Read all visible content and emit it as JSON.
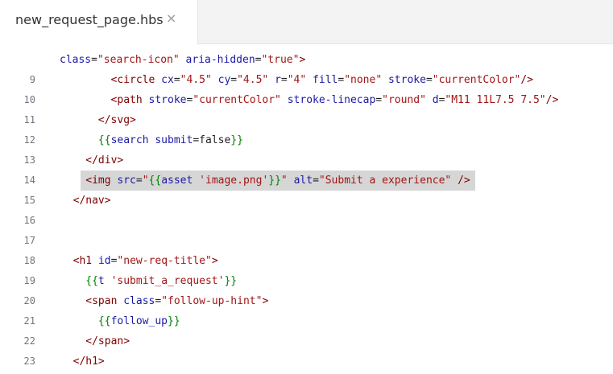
{
  "tab": {
    "filename": "new_request_page.hbs",
    "close_glyph": "×"
  },
  "lines": [
    {
      "number": "",
      "indent": 0,
      "highlight": false,
      "tokens": [
        {
          "t": "attr",
          "v": "class"
        },
        {
          "t": "plain",
          "v": "="
        },
        {
          "t": "str",
          "v": "\"search-icon\""
        },
        {
          "t": "plain",
          "v": " "
        },
        {
          "t": "attr",
          "v": "aria-hidden"
        },
        {
          "t": "plain",
          "v": "="
        },
        {
          "t": "str",
          "v": "\"true\""
        },
        {
          "t": "tag",
          "v": ">"
        }
      ]
    },
    {
      "number": "9",
      "indent": 8,
      "highlight": false,
      "tokens": [
        {
          "t": "tag",
          "v": "<circle"
        },
        {
          "t": "plain",
          "v": " "
        },
        {
          "t": "attr",
          "v": "cx"
        },
        {
          "t": "plain",
          "v": "="
        },
        {
          "t": "str",
          "v": "\"4.5\""
        },
        {
          "t": "plain",
          "v": " "
        },
        {
          "t": "attr",
          "v": "cy"
        },
        {
          "t": "plain",
          "v": "="
        },
        {
          "t": "str",
          "v": "\"4.5\""
        },
        {
          "t": "plain",
          "v": " "
        },
        {
          "t": "attr",
          "v": "r"
        },
        {
          "t": "plain",
          "v": "="
        },
        {
          "t": "str",
          "v": "\"4\""
        },
        {
          "t": "plain",
          "v": " "
        },
        {
          "t": "attr",
          "v": "fill"
        },
        {
          "t": "plain",
          "v": "="
        },
        {
          "t": "str",
          "v": "\"none\""
        },
        {
          "t": "plain",
          "v": " "
        },
        {
          "t": "attr",
          "v": "stroke"
        },
        {
          "t": "plain",
          "v": "="
        },
        {
          "t": "str",
          "v": "\"currentColor\""
        },
        {
          "t": "tag",
          "v": "/>"
        }
      ]
    },
    {
      "number": "10",
      "indent": 8,
      "highlight": false,
      "tokens": [
        {
          "t": "tag",
          "v": "<path"
        },
        {
          "t": "plain",
          "v": " "
        },
        {
          "t": "attr",
          "v": "stroke"
        },
        {
          "t": "plain",
          "v": "="
        },
        {
          "t": "str",
          "v": "\"currentColor\""
        },
        {
          "t": "plain",
          "v": " "
        },
        {
          "t": "attr",
          "v": "stroke-linecap"
        },
        {
          "t": "plain",
          "v": "="
        },
        {
          "t": "str",
          "v": "\"round\""
        },
        {
          "t": "plain",
          "v": " "
        },
        {
          "t": "attr",
          "v": "d"
        },
        {
          "t": "plain",
          "v": "="
        },
        {
          "t": "str",
          "v": "\"M11 11L7.5 7.5\""
        },
        {
          "t": "tag",
          "v": "/>"
        }
      ]
    },
    {
      "number": "11",
      "indent": 6,
      "highlight": false,
      "tokens": [
        {
          "t": "tag",
          "v": "</svg>"
        }
      ]
    },
    {
      "number": "12",
      "indent": 6,
      "highlight": false,
      "tokens": [
        {
          "t": "hbs",
          "v": "{{"
        },
        {
          "t": "attr",
          "v": "search"
        },
        {
          "t": "plain",
          "v": " "
        },
        {
          "t": "attr",
          "v": "submit"
        },
        {
          "t": "plain",
          "v": "=false"
        },
        {
          "t": "hbs",
          "v": "}}"
        }
      ]
    },
    {
      "number": "13",
      "indent": 4,
      "highlight": false,
      "tokens": [
        {
          "t": "tag",
          "v": "</div>"
        }
      ]
    },
    {
      "number": "14",
      "indent": 4,
      "highlight": true,
      "tokens": [
        {
          "t": "tag",
          "v": "<img"
        },
        {
          "t": "plain",
          "v": " "
        },
        {
          "t": "attr",
          "v": "src"
        },
        {
          "t": "plain",
          "v": "="
        },
        {
          "t": "str",
          "v": "\""
        },
        {
          "t": "hbs",
          "v": "{{"
        },
        {
          "t": "attr",
          "v": "asset"
        },
        {
          "t": "plain",
          "v": " "
        },
        {
          "t": "str",
          "v": "'image.png'"
        },
        {
          "t": "hbs",
          "v": "}}"
        },
        {
          "t": "str",
          "v": "\""
        },
        {
          "t": "plain",
          "v": " "
        },
        {
          "t": "attr",
          "v": "alt"
        },
        {
          "t": "plain",
          "v": "="
        },
        {
          "t": "str",
          "v": "\"Submit a experience\""
        },
        {
          "t": "plain",
          "v": " "
        },
        {
          "t": "tag",
          "v": "/>"
        }
      ]
    },
    {
      "number": "15",
      "indent": 2,
      "highlight": false,
      "tokens": [
        {
          "t": "tag",
          "v": "</nav>"
        }
      ]
    },
    {
      "number": "16",
      "indent": 0,
      "highlight": false,
      "tokens": []
    },
    {
      "number": "17",
      "indent": 0,
      "highlight": false,
      "tokens": []
    },
    {
      "number": "18",
      "indent": 2,
      "highlight": false,
      "tokens": [
        {
          "t": "tag",
          "v": "<h1"
        },
        {
          "t": "plain",
          "v": " "
        },
        {
          "t": "attr",
          "v": "id"
        },
        {
          "t": "plain",
          "v": "="
        },
        {
          "t": "str",
          "v": "\"new-req-title\""
        },
        {
          "t": "tag",
          "v": ">"
        }
      ]
    },
    {
      "number": "19",
      "indent": 4,
      "highlight": false,
      "tokens": [
        {
          "t": "hbs",
          "v": "{{"
        },
        {
          "t": "attr",
          "v": "t"
        },
        {
          "t": "plain",
          "v": " "
        },
        {
          "t": "str",
          "v": "'submit_a_request'"
        },
        {
          "t": "hbs",
          "v": "}}"
        }
      ]
    },
    {
      "number": "20",
      "indent": 4,
      "highlight": false,
      "tokens": [
        {
          "t": "tag",
          "v": "<span"
        },
        {
          "t": "plain",
          "v": " "
        },
        {
          "t": "attr",
          "v": "class"
        },
        {
          "t": "plain",
          "v": "="
        },
        {
          "t": "str",
          "v": "\"follow-up-hint\""
        },
        {
          "t": "tag",
          "v": ">"
        }
      ]
    },
    {
      "number": "21",
      "indent": 6,
      "highlight": false,
      "tokens": [
        {
          "t": "hbs",
          "v": "{{"
        },
        {
          "t": "attr",
          "v": "follow_up"
        },
        {
          "t": "hbs",
          "v": "}}"
        }
      ]
    },
    {
      "number": "22",
      "indent": 4,
      "highlight": false,
      "tokens": [
        {
          "t": "tag",
          "v": "</span>"
        }
      ]
    },
    {
      "number": "23",
      "indent": 2,
      "highlight": false,
      "tokens": [
        {
          "t": "tag",
          "v": "</h1>"
        }
      ]
    }
  ]
}
